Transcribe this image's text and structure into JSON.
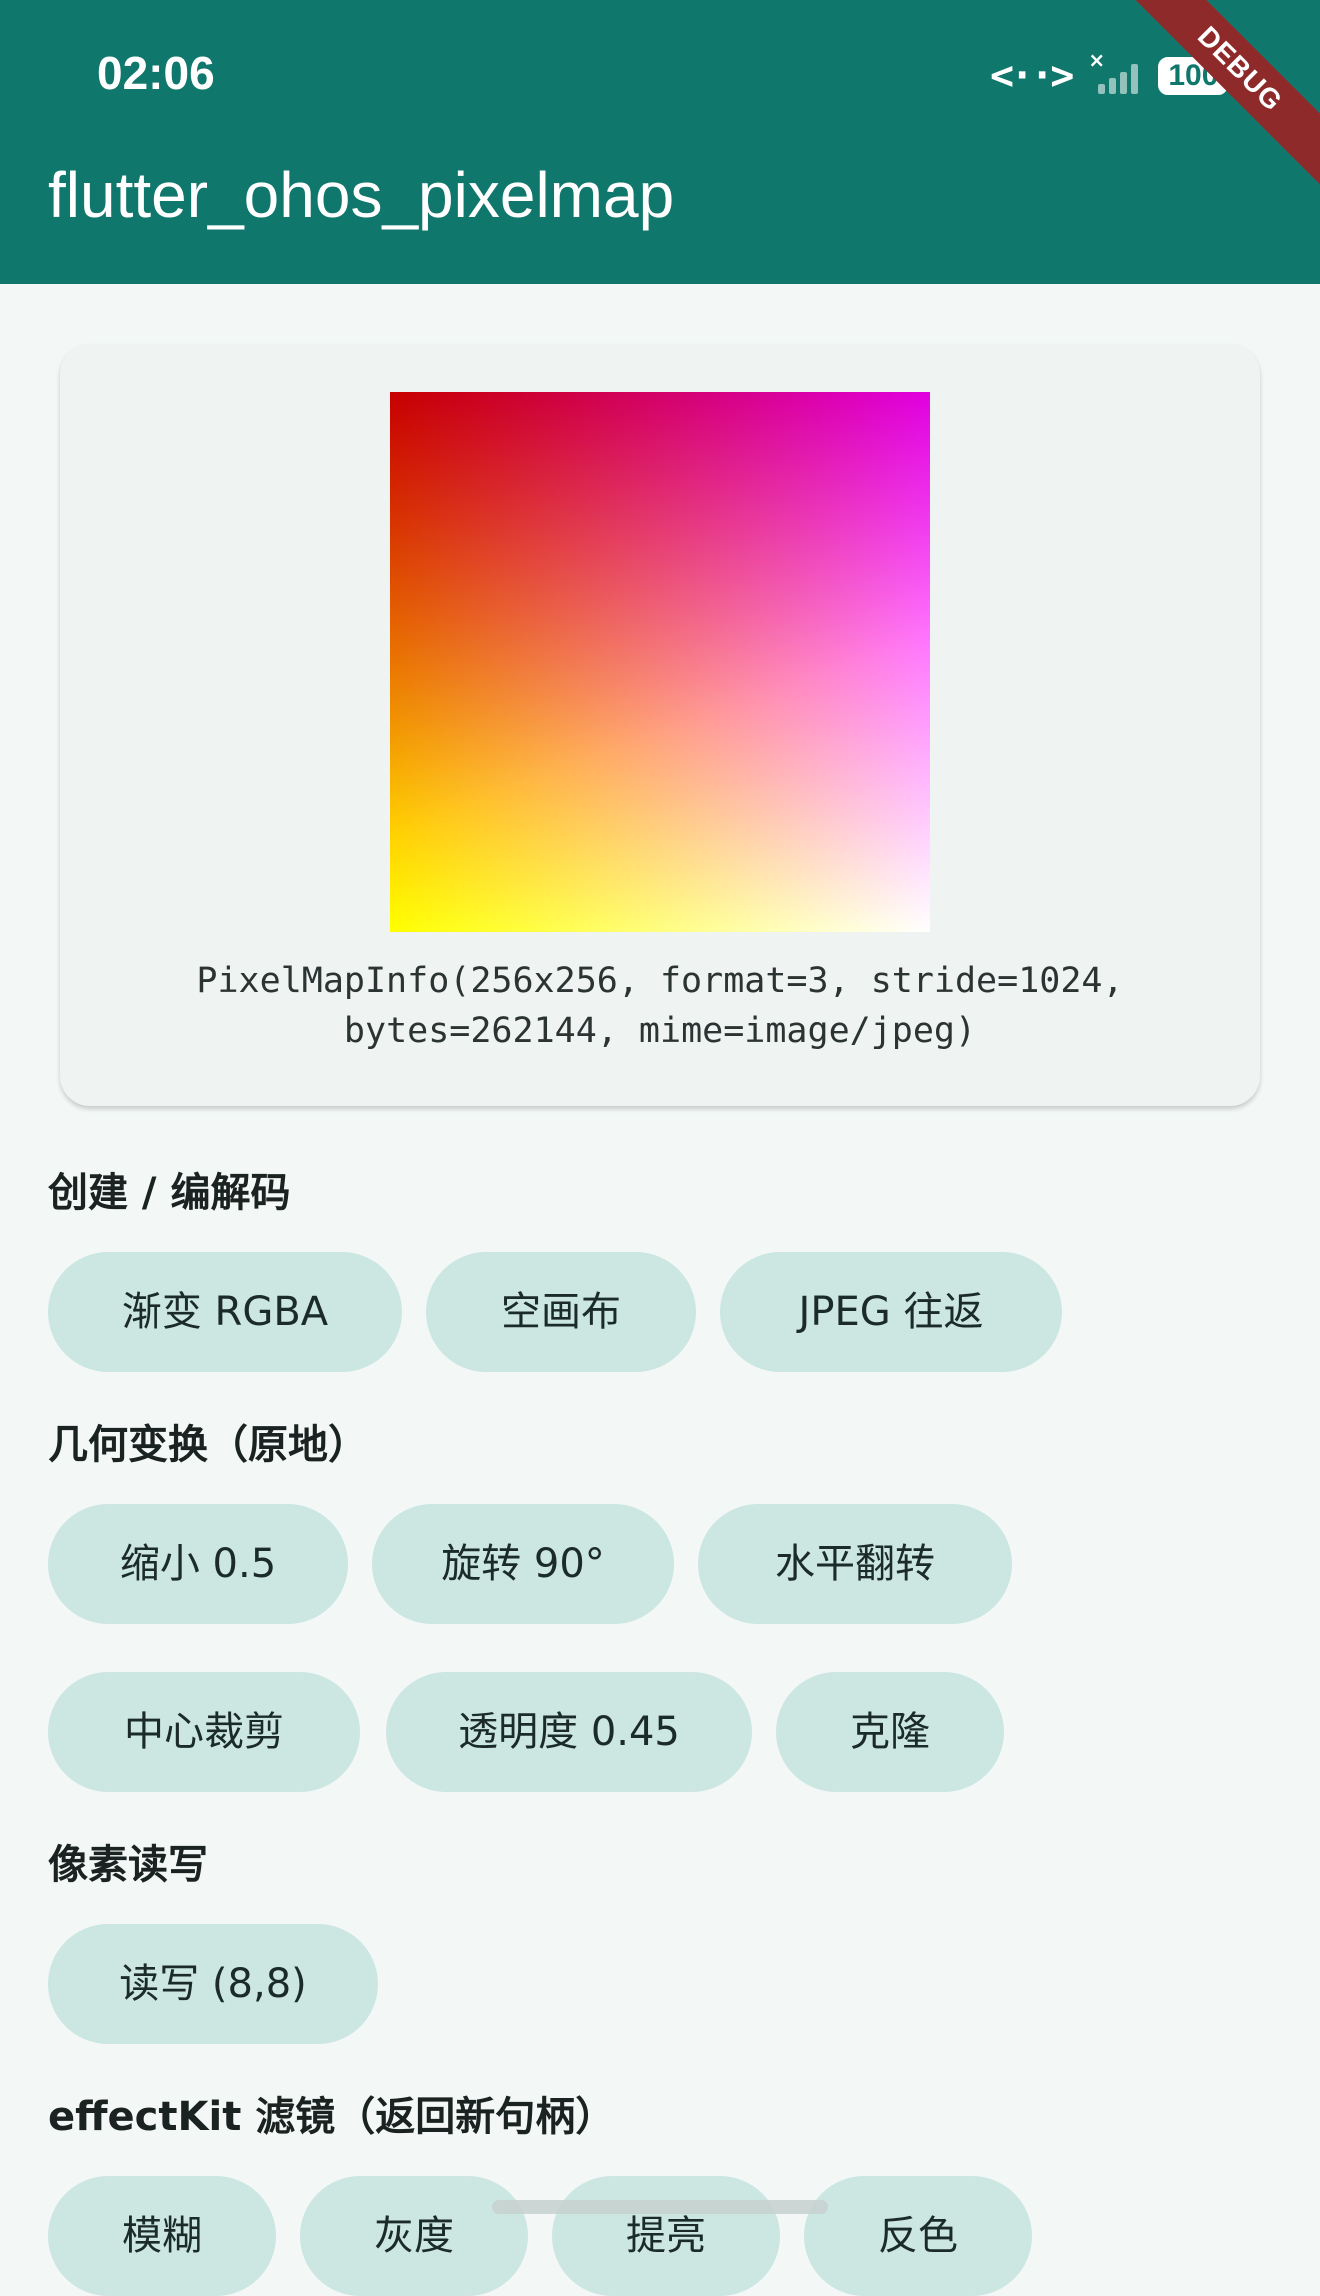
{
  "status_bar": {
    "time": "02:06",
    "battery": "100",
    "network_icon": "data-transfer-icon",
    "signal_icon": "signal-icon"
  },
  "app_bar": {
    "title": "flutter_ohos_pixelmap",
    "debug_banner": "DEBUG",
    "color": "#10776c"
  },
  "preview": {
    "info_text": "PixelMapInfo(256x256, format=3, stride=1024,\nbytes=262144, mime=image/jpeg)"
  },
  "sections": [
    {
      "title": "创建 / 编解码",
      "buttons": [
        "渐变 RGBA",
        "空画布",
        "JPEG 往返"
      ]
    },
    {
      "title": "几何变换（原地）",
      "buttons": [
        "缩小 0.5",
        "旋转 90°",
        "水平翻转",
        "中心裁剪",
        "透明度 0.45",
        "克隆"
      ]
    },
    {
      "title": "像素读写",
      "buttons": [
        "读写 (8,8)"
      ]
    },
    {
      "title": "effectKit 滤镜（返回新句柄）",
      "buttons": [
        "模糊",
        "灰度",
        "提亮",
        "反色"
      ]
    }
  ],
  "colors": {
    "background": "#f3f8f6",
    "chip": "#cce6e2",
    "card": "#eff3f2",
    "debug": "#8e2a2a"
  }
}
